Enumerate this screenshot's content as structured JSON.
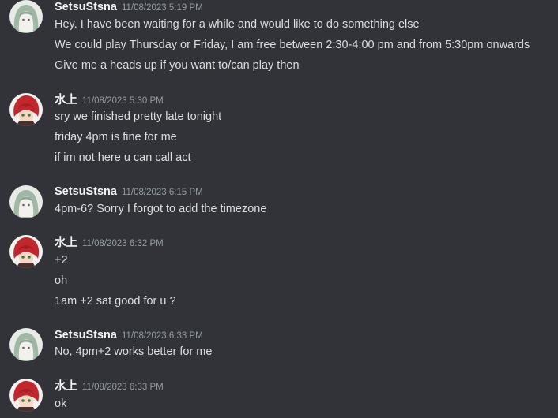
{
  "colors": {
    "background": "#313338",
    "username": "#f2f3f5",
    "timestamp": "#949ba4",
    "text": "#dbdee1"
  },
  "groups": [
    {
      "username": "SetsuStsna",
      "timestamp": "11/08/2023 5:19 PM",
      "avatar": "green-haired-girl-avatar",
      "lines": [
        "Hey. I have been waiting for a while and would like to do something else",
        "We could play Thursday or Friday, I am free between 2:30-4:00 pm and from 5:30pm onwards",
        "Give me a heads up if you want to/can play then"
      ]
    },
    {
      "username": "水上",
      "timestamp": "11/08/2023 5:30 PM",
      "avatar": "red-haired-character-avatar",
      "lines": [
        "sry we finished pretty late tonight",
        "friday 4pm is fine for me",
        "if im not here u can call act"
      ]
    },
    {
      "username": "SetsuStsna",
      "timestamp": "11/08/2023 6:15 PM",
      "avatar": "green-haired-girl-avatar",
      "lines": [
        "4pm-6? Sorry I forgot to add the timezone"
      ]
    },
    {
      "username": "水上",
      "timestamp": "11/08/2023 6:32 PM",
      "avatar": "red-haired-character-avatar",
      "lines": [
        "+2",
        "oh",
        "1am +2 sat good for u ?"
      ]
    },
    {
      "username": "SetsuStsna",
      "timestamp": "11/08/2023 6:33 PM",
      "avatar": "green-haired-girl-avatar",
      "lines": [
        "No, 4pm+2 works better for me"
      ]
    },
    {
      "username": "水上",
      "timestamp": "11/08/2023 6:33 PM",
      "avatar": "red-haired-character-avatar",
      "lines": [
        "ok"
      ]
    }
  ]
}
